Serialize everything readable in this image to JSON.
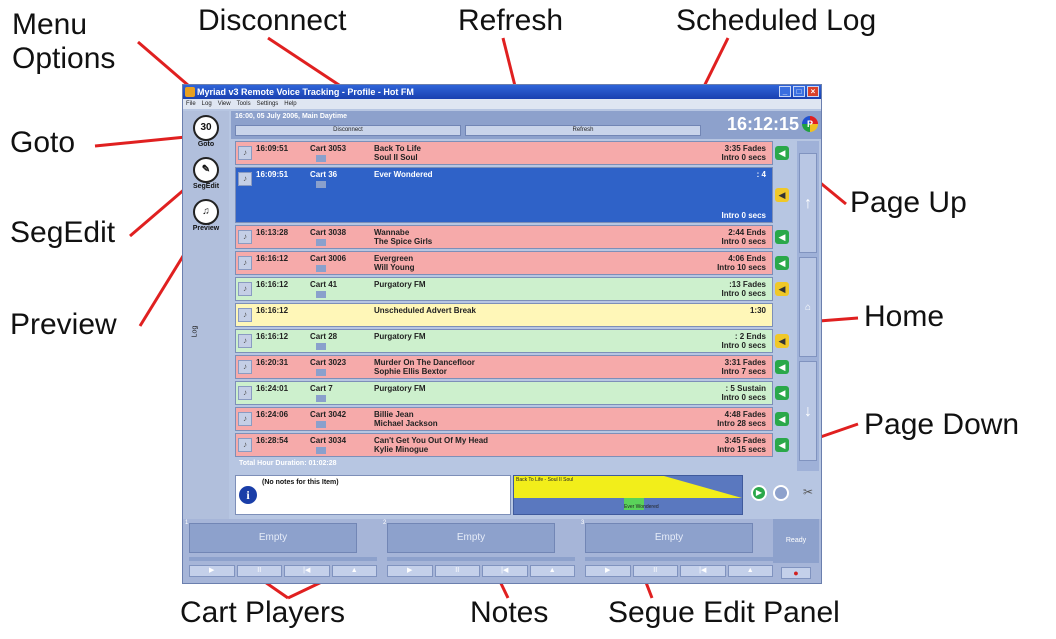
{
  "callouts": {
    "menu_options": "Menu\nOptions",
    "disconnect": "Disconnect",
    "refresh": "Refresh",
    "scheduled_log": "Scheduled Log",
    "goto": "Goto",
    "segedit": "SegEdit",
    "preview": "Preview",
    "page_up": "Page Up",
    "home": "Home",
    "page_down": "Page Down",
    "cart_players": "Cart Players",
    "notes": "Notes",
    "segue_edit_panel": "Segue Edit Panel"
  },
  "app": {
    "title": "Myriad v3 Remote Voice Tracking - Profile - Hot FM",
    "menu": [
      "File",
      "Log",
      "View",
      "Tools",
      "Settings",
      "Help"
    ],
    "nav": {
      "goto_label": "Goto",
      "goto_icon_text": "30",
      "segedit_label": "SegEdit",
      "preview_label": "Preview",
      "log_label": "Log"
    },
    "header": {
      "info": "16:00, 05 July 2006, Main Daytime",
      "disconnect": "Disconnect",
      "refresh": "Refresh",
      "clock": "16:12:15",
      "logo": "P"
    },
    "log_rows": [
      {
        "time": "16:09:51",
        "cart": "Cart 3053",
        "t1": "Back To Life",
        "t2": "Soul II Soul",
        "dur": "3:35 Fades",
        "intro": "Intro  0 secs",
        "color": "red",
        "side": "g"
      },
      {
        "time": "16:09:51",
        "cart": "Cart 36",
        "t1": "Ever Wondered",
        "t2": "",
        "dur": ": 4",
        "intro": "Intro  0 secs",
        "color": "blue",
        "side": "y"
      },
      {
        "time": "16:13:28",
        "cart": "Cart 3038",
        "t1": "Wannabe",
        "t2": "The Spice Girls",
        "dur": "2:44 Ends",
        "intro": "Intro  0 secs",
        "color": "red",
        "side": "g"
      },
      {
        "time": "16:16:12",
        "cart": "Cart 3006",
        "t1": "Evergreen",
        "t2": "Will Young",
        "dur": "4:06 Ends",
        "intro": "Intro 10 secs",
        "color": "red",
        "side": "g"
      },
      {
        "time": "16:16:12",
        "cart": "Cart 41",
        "t1": "Purgatory FM",
        "t2": "",
        "dur": ":13 Fades",
        "intro": "Intro  0 secs",
        "color": "green",
        "side": "y"
      },
      {
        "time": "16:16:12",
        "cart": "",
        "t1": "Unscheduled Advert Break",
        "t2": "",
        "dur": "1:30",
        "intro": "",
        "color": "yellow",
        "side": ""
      },
      {
        "time": "16:16:12",
        "cart": "Cart 28",
        "t1": "Purgatory FM",
        "t2": "",
        "dur": ": 2 Ends",
        "intro": "Intro  0 secs",
        "color": "green",
        "side": "y"
      },
      {
        "time": "16:20:31",
        "cart": "Cart 3023",
        "t1": "Murder On The Dancefloor",
        "t2": "Sophie Ellis Bextor",
        "dur": "3:31 Fades",
        "intro": "Intro  7 secs",
        "color": "red",
        "side": "g"
      },
      {
        "time": "16:24:01",
        "cart": "Cart 7",
        "t1": "Purgatory FM",
        "t2": "",
        "dur": ": 5 Sustain",
        "intro": "Intro  0 secs",
        "color": "green",
        "side": "g"
      },
      {
        "time": "16:24:06",
        "cart": "Cart 3042",
        "t1": "Billie Jean",
        "t2": "Michael Jackson",
        "dur": "4:48 Fades",
        "intro": "Intro 28 secs",
        "color": "red",
        "side": "g"
      },
      {
        "time": "16:28:54",
        "cart": "Cart 3034",
        "t1": "Can't Get You Out Of My Head",
        "t2": "Kylie Minogue",
        "dur": "3:45 Fades",
        "intro": "Intro 15 secs",
        "color": "red",
        "side": "g"
      }
    ],
    "total": "Total Hour Duration:  01:02:28",
    "notes": "(No notes for this Item)",
    "segue": {
      "label": "Back To Life - Soul II Soul",
      "label2": "Ever Wondered"
    },
    "players": [
      {
        "num": "1",
        "label": "Empty"
      },
      {
        "num": "2",
        "label": "Empty"
      },
      {
        "num": "3",
        "label": "Empty"
      }
    ],
    "ready": "Ready"
  }
}
